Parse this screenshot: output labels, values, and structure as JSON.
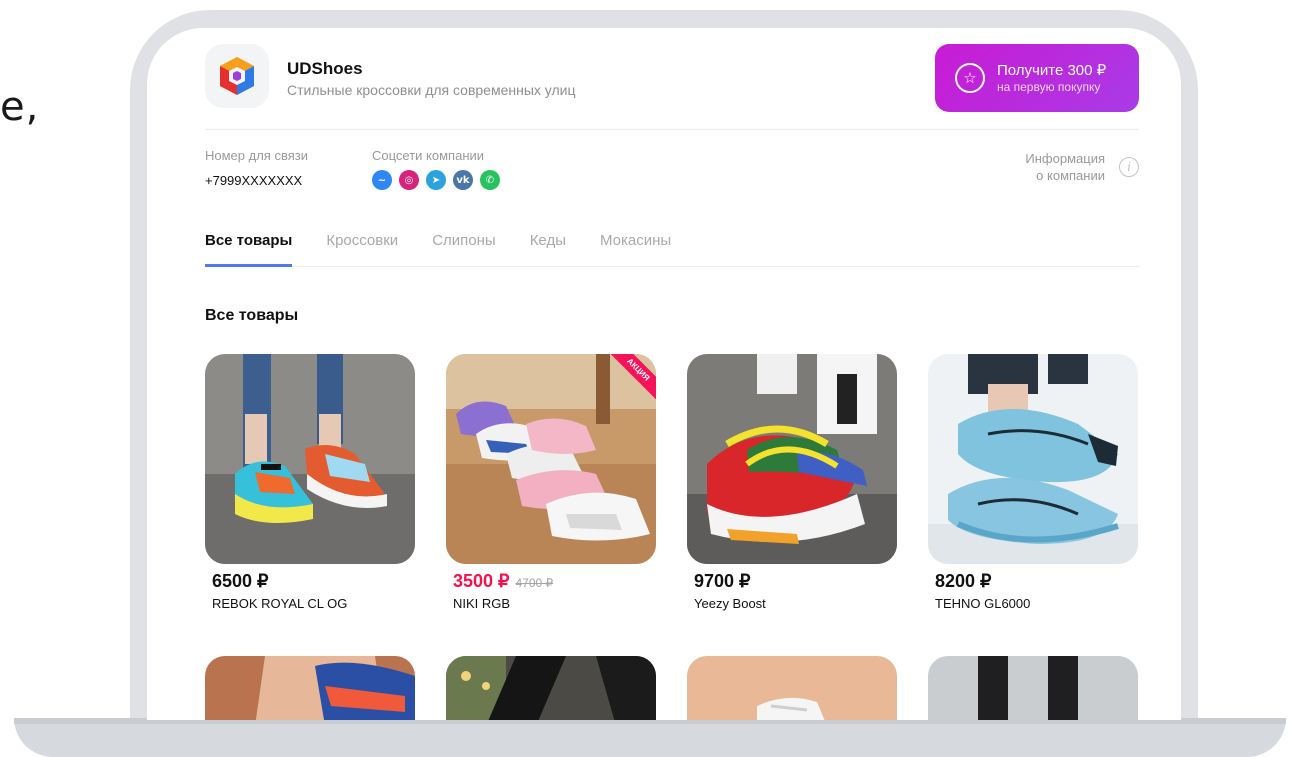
{
  "side_text": "e,",
  "shop": {
    "name": "UDShoes",
    "tagline": "Стильные кроссовки для современных улиц"
  },
  "promo": {
    "title": "Получите 300 ₽",
    "subtitle": "на первую покупку"
  },
  "contact": {
    "label": "Номер для связи",
    "phone": "+7999XXXXXXX"
  },
  "socials": {
    "label": "Соцсети компании",
    "items": [
      {
        "name": "messenger-icon",
        "glyph": "~",
        "color": "#2f86f5"
      },
      {
        "name": "instagram-icon",
        "glyph": "◎",
        "color": "#d6247b"
      },
      {
        "name": "telegram-icon",
        "glyph": "➤",
        "color": "#2aa3df"
      },
      {
        "name": "vk-icon",
        "glyph": "vk",
        "color": "#4a76a8"
      },
      {
        "name": "whatsapp-icon",
        "glyph": "✆",
        "color": "#25c25e"
      }
    ]
  },
  "company_info": {
    "line1": "Информация",
    "line2": "о компании"
  },
  "tabs": [
    {
      "label": "Все товары",
      "active": true
    },
    {
      "label": "Кроссовки",
      "active": false
    },
    {
      "label": "Слипоны",
      "active": false
    },
    {
      "label": "Кеды",
      "active": false
    },
    {
      "label": "Мокасины",
      "active": false
    }
  ],
  "section_title": "Все товары",
  "products": [
    {
      "price": "6500 ₽",
      "old_price": "",
      "name": "REBOK ROYAL CL OG",
      "sale": false
    },
    {
      "price": "3500 ₽",
      "old_price": "4700 ₽",
      "name": "NIKI RGB",
      "sale": true,
      "ribbon": "АКЦИЯ"
    },
    {
      "price": "9700 ₽",
      "old_price": "",
      "name": "Yeezy Boost",
      "sale": false
    },
    {
      "price": "8200 ₽",
      "old_price": "",
      "name": "TEHNO GL6000",
      "sale": false
    }
  ],
  "colors": {
    "accent": "#4f7be8",
    "promo_start": "#c81bd4",
    "promo_end": "#a93be6",
    "sale": "#f3124c"
  }
}
